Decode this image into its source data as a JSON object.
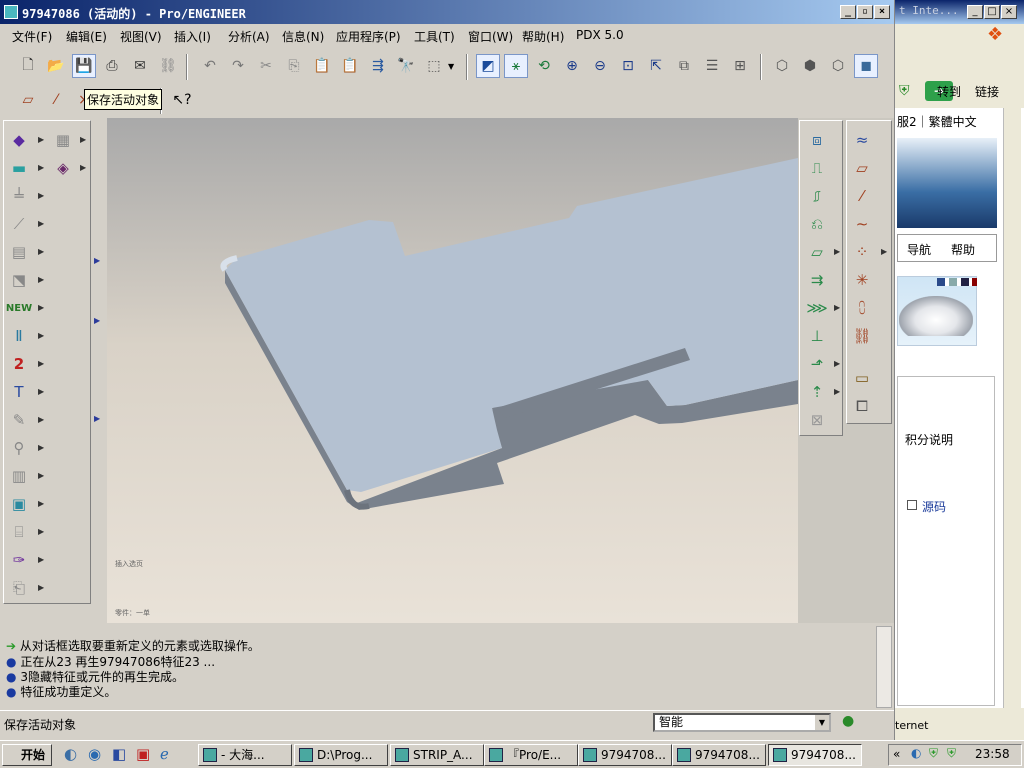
{
  "window": {
    "title": "97947086 (活动的) - Pro/ENGINEER"
  },
  "menus": [
    "文件(F)",
    "编辑(E)",
    "视图(V)",
    "插入(I)",
    "分析(A)",
    "信息(N)",
    "应用程序(P)",
    "工具(T)",
    "窗口(W)",
    "帮助(H)",
    "PDX 5.0"
  ],
  "tooltip": "保存活动对象",
  "viewport": {
    "label1": "插入选页",
    "label2": "零件：一单"
  },
  "messages": [
    {
      "icon": "arrow",
      "text": "从对话框选取要重新定义的元素或选取操作。"
    },
    {
      "icon": "dot",
      "text": "正在从23 再生97947086特征23 ..."
    },
    {
      "icon": "dot",
      "text": "3隐藏特征或元件的再生完成。"
    },
    {
      "icon": "dot",
      "text": "特征成功重定义。"
    }
  ],
  "status": {
    "text": "保存活动对象",
    "filter": "智能"
  },
  "background_window": {
    "title_fragment": "t Inte...",
    "go_label": "转到",
    "links_label": "链接",
    "nav_text": "服2｜繁體中文",
    "tab_nav": "导航",
    "tab_help": "帮助",
    "points_label": "积分说明",
    "source_label": "源码",
    "status_fragment": "ternet"
  },
  "taskbar": {
    "start": "开始",
    "tasks": [
      {
        "label": "- 大海..."
      },
      {
        "label": "D:\\Prog..."
      },
      {
        "label": "STRIP_A..."
      },
      {
        "label": "『Pro/E..."
      },
      {
        "label": "9794708..."
      },
      {
        "label": "9794708..."
      },
      {
        "label": "9794708...",
        "active": true
      }
    ],
    "clock": "23:58"
  },
  "colors": {
    "titlebar_start": "#0a246a",
    "model_top": "#b4c2d2",
    "model_edge": "#78808a"
  }
}
